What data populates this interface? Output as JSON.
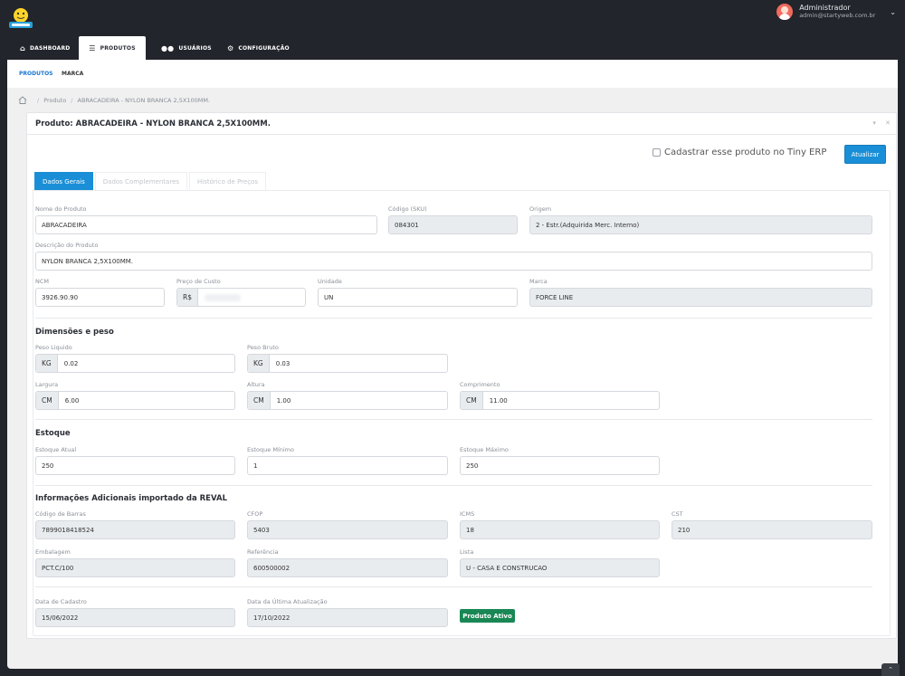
{
  "header": {
    "user_name": "Administrador",
    "user_email": "admin@startyweb.com.br"
  },
  "nav": {
    "dashboard": "DASHBOARD",
    "produtos": "PRODUTOS",
    "usuarios": "USUÁRIOS",
    "configuracao": "CONFIGURAÇÃO"
  },
  "subnav": {
    "produtos": "PRODUTOS",
    "marca": "MARCA"
  },
  "breadcrumb": {
    "produto": "Produto",
    "current": "ABRACADEIRA - NYLON BRANCA 2,5X100MM."
  },
  "card": {
    "title": "Produto: ABRACADEIRA - NYLON BRANCA 2,5X100MM."
  },
  "tiny_label": "Cadastrar esse produto no Tiny ERP",
  "update_button": "Atualizar",
  "tabs": {
    "gerais": "Dados Gerais",
    "complementares": "Dados Complementares",
    "historico": "Histórico de Preços"
  },
  "fields": {
    "nome_label": "Nome do Produto",
    "nome": "ABRACADEIRA",
    "sku_label": "Código (SKU)",
    "sku": "084301",
    "origem_label": "Origem",
    "origem": "2 - Estr.(Adquirida Merc. Interno)",
    "descricao_label": "Descrição do Produto",
    "descricao": "NYLON BRANCA 2,5X100MM.",
    "ncm_label": "NCM",
    "ncm": "3926.90.90",
    "custo_label": "Preço de Custo",
    "custo_prefix": "R$",
    "unidade_label": "Unidade",
    "unidade": "UN",
    "marca_label": "Marca",
    "marca": "FORCE LINE"
  },
  "dimensoes": {
    "title": "Dimensões e peso",
    "liquido_label": "Peso Liquido",
    "liquido_unit": "KG",
    "liquido": "0.02",
    "bruto_label": "Peso Bruto",
    "bruto_unit": "KG",
    "bruto": "0.03",
    "largura_label": "Largura",
    "largura_unit": "CM",
    "largura": "6.00",
    "altura_label": "Altura",
    "altura_unit": "CM",
    "altura": "1.00",
    "comprimento_label": "Comprimento",
    "comprimento_unit": "CM",
    "comprimento": "11.00"
  },
  "estoque": {
    "title": "Estoque",
    "atual_label": "Estoque Atual",
    "atual": "250",
    "minimo_label": "Estoque Mínimo",
    "minimo": "1",
    "maximo_label": "Estoque Máximo",
    "maximo": "250"
  },
  "reval": {
    "title": "Informações Adicionais importado da REVAL",
    "barras_label": "Código de Barras",
    "barras": "7899018418524",
    "cfop_label": "CFOP",
    "cfop": "5403",
    "icms_label": "ICMS",
    "icms": "18",
    "cst_label": "CST",
    "cst": "210",
    "embalagem_label": "Embalagem",
    "embalagem": "PCT.C/100",
    "referencia_label": "Referência",
    "referencia": "600500002",
    "lista_label": "Lista",
    "lista": "U - CASA E CONSTRUCAO"
  },
  "datas": {
    "cadastro_label": "Data de Cadastro",
    "cadastro": "15/06/2022",
    "atualizacao_label": "Data da Última Atualização",
    "atualizacao": "17/10/2022",
    "status": "Produto Ativo"
  },
  "colors": {
    "accent": "#1a8fd7",
    "success": "#198754",
    "topbar": "#22252b"
  }
}
